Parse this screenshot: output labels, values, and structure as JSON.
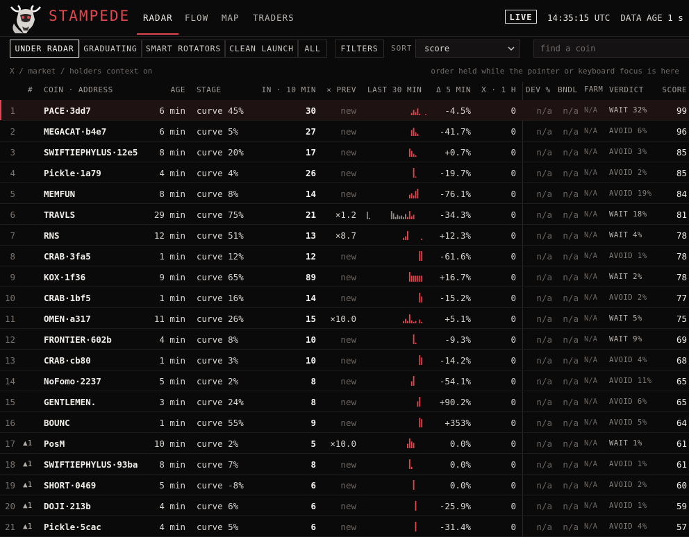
{
  "brand": "STAMPEDE",
  "nav": [
    "RADAR",
    "FLOW",
    "MAP",
    "TRADERS"
  ],
  "status": {
    "live": "LIVE",
    "time": "14:35:15",
    "tz": "UTC",
    "age_label": "DATA AGE",
    "age_value": "1 s"
  },
  "filters": [
    "UNDER RADAR",
    "GRADUATING",
    "SMART ROTATORS",
    "CLEAN LAUNCH",
    "ALL"
  ],
  "filters_button": "FILTERS",
  "sort": {
    "label": "SORT",
    "value": "score"
  },
  "search": {
    "placeholder": "find a coin"
  },
  "context": {
    "left": "X / market / holders context on",
    "right": "order held while the pointer or keyboard focus is here"
  },
  "columns": {
    "num": "#",
    "coin": "COIN · ADDRESS",
    "age": "AGE",
    "stage": "STAGE",
    "in10": "IN · 10 MIN",
    "prev": "× PREV",
    "last30": "LAST 30 MIN",
    "d5": "Δ 5 MIN",
    "x1h": "X · 1 H",
    "dev": "DEV %",
    "bndl": "BNDL",
    "farm": "FARM",
    "verdict": "VERDICT",
    "score": "SCORE"
  },
  "colors": {
    "accent": "#e0464e",
    "wait": "#b9b3ae",
    "avoid": "#85807b"
  },
  "rows": [
    {
      "num": "1",
      "trend": "",
      "coin": "PACE·3dd7",
      "age": "6 min",
      "stage": "curve 45%",
      "in10": "30",
      "prev": "new",
      "spark": [
        0,
        0,
        0,
        0,
        0,
        0,
        0,
        0,
        0,
        0,
        0,
        0,
        0,
        0,
        0,
        0,
        0,
        0,
        0,
        0,
        0,
        0,
        3,
        7,
        4,
        9,
        2,
        0,
        0,
        1
      ],
      "d5": "-4.5%",
      "x1h": "0",
      "dev": "n/a",
      "bndl": "n/a",
      "farm": "N/A",
      "verdict": "WAIT 32%",
      "score": "99"
    },
    {
      "num": "2",
      "trend": "",
      "coin": "MEGACAT·b4e7",
      "age": "6 min",
      "stage": "curve 5%",
      "in10": "27",
      "prev": "new",
      "spark": [
        0,
        0,
        0,
        0,
        0,
        0,
        0,
        0,
        0,
        0,
        0,
        0,
        0,
        0,
        0,
        0,
        0,
        0,
        0,
        0,
        0,
        0,
        8,
        11,
        5,
        3,
        0,
        0,
        0,
        0
      ],
      "d5": "-41.7%",
      "x1h": "0",
      "dev": "n/a",
      "bndl": "n/a",
      "farm": "N/A",
      "verdict": "AVOID 6%",
      "score": "96"
    },
    {
      "num": "3",
      "trend": "",
      "coin": "SWIFTIEPHYLUS·12e5",
      "age": "8 min",
      "stage": "curve 20%",
      "in10": "17",
      "prev": "new",
      "spark": [
        0,
        0,
        0,
        0,
        0,
        0,
        0,
        0,
        0,
        0,
        0,
        0,
        0,
        0,
        0,
        0,
        0,
        0,
        0,
        0,
        0,
        11,
        8,
        4,
        2,
        0,
        0,
        0,
        0,
        0
      ],
      "d5": "+0.7%",
      "x1h": "0",
      "dev": "n/a",
      "bndl": "n/a",
      "farm": "N/A",
      "verdict": "AVOID 3%",
      "score": "85"
    },
    {
      "num": "4",
      "trend": "",
      "coin": "Pickle·1a79",
      "age": "4 min",
      "stage": "curve 4%",
      "in10": "26",
      "prev": "new",
      "spark": [
        0,
        0,
        0,
        0,
        0,
        0,
        0,
        0,
        0,
        0,
        0,
        0,
        0,
        0,
        0,
        0,
        0,
        0,
        0,
        0,
        0,
        0,
        0,
        13,
        1,
        0,
        0,
        0,
        0,
        0
      ],
      "d5": "-19.7%",
      "x1h": "0",
      "dev": "n/a",
      "bndl": "n/a",
      "farm": "N/A",
      "verdict": "AVOID 2%",
      "score": "85"
    },
    {
      "num": "5",
      "trend": "",
      "coin": "MEMFUN",
      "age": "8 min",
      "stage": "curve 8%",
      "in10": "14",
      "prev": "new",
      "spark": [
        0,
        0,
        0,
        0,
        0,
        0,
        0,
        0,
        0,
        0,
        0,
        0,
        0,
        0,
        0,
        0,
        0,
        0,
        0,
        0,
        0,
        5,
        7,
        4,
        10,
        13,
        0,
        0,
        0,
        0
      ],
      "d5": "-76.1%",
      "x1h": "0",
      "dev": "n/a",
      "bndl": "n/a",
      "farm": "N/A",
      "verdict": "AVOID 19%",
      "score": "84"
    },
    {
      "num": "6",
      "trend": "",
      "coin": "TRAVLS",
      "age": "29 min",
      "stage": "curve 75%",
      "in10": "21",
      "prev": "×1.2",
      "spark": [
        10,
        2,
        0,
        0,
        0,
        0,
        0,
        0,
        0,
        0,
        0,
        0,
        11,
        8,
        3,
        6,
        4,
        5,
        3,
        7,
        3,
        11,
        4,
        6,
        0,
        0,
        0,
        0,
        0,
        0
      ],
      "d5": "-34.3%",
      "x1h": "0",
      "dev": "n/a",
      "bndl": "n/a",
      "farm": "N/A",
      "verdict": "WAIT 18%",
      "score": "81"
    },
    {
      "num": "7",
      "trend": "",
      "coin": "RNS",
      "age": "12 min",
      "stage": "curve 51%",
      "in10": "13",
      "prev": "×8.7",
      "spark": [
        0,
        0,
        0,
        0,
        0,
        0,
        0,
        0,
        0,
        0,
        0,
        0,
        0,
        0,
        0,
        0,
        0,
        0,
        3,
        5,
        12,
        0,
        0,
        0,
        0,
        0,
        0,
        2,
        0,
        0
      ],
      "d5": "+12.3%",
      "x1h": "0",
      "dev": "n/a",
      "bndl": "n/a",
      "farm": "N/A",
      "verdict": "WAIT 4%",
      "score": "78"
    },
    {
      "num": "8",
      "trend": "",
      "coin": "CRAB·3fa5",
      "age": "1 min",
      "stage": "curve 12%",
      "in10": "12",
      "prev": "new",
      "spark": [
        0,
        0,
        0,
        0,
        0,
        0,
        0,
        0,
        0,
        0,
        0,
        0,
        0,
        0,
        0,
        0,
        0,
        0,
        0,
        0,
        0,
        0,
        0,
        0,
        0,
        0,
        13,
        13,
        0,
        0
      ],
      "d5": "-61.6%",
      "x1h": "0",
      "dev": "n/a",
      "bndl": "n/a",
      "farm": "N/A",
      "verdict": "AVOID 1%",
      "score": "78"
    },
    {
      "num": "9",
      "trend": "",
      "coin": "KOX·1f36",
      "age": "9 min",
      "stage": "curve 65%",
      "in10": "89",
      "prev": "new",
      "spark": [
        0,
        0,
        0,
        0,
        0,
        0,
        0,
        0,
        0,
        0,
        0,
        0,
        0,
        0,
        0,
        0,
        0,
        0,
        0,
        0,
        0,
        13,
        8,
        8,
        8,
        8,
        8,
        8,
        0,
        0
      ],
      "d5": "+16.7%",
      "x1h": "0",
      "dev": "n/a",
      "bndl": "n/a",
      "farm": "N/A",
      "verdict": "WAIT 2%",
      "score": "78"
    },
    {
      "num": "10",
      "trend": "",
      "coin": "CRAB·1bf5",
      "age": "1 min",
      "stage": "curve 16%",
      "in10": "14",
      "prev": "new",
      "spark": [
        0,
        0,
        0,
        0,
        0,
        0,
        0,
        0,
        0,
        0,
        0,
        0,
        0,
        0,
        0,
        0,
        0,
        0,
        0,
        0,
        0,
        0,
        0,
        0,
        0,
        0,
        13,
        8,
        0,
        0
      ],
      "d5": "-15.2%",
      "x1h": "0",
      "dev": "n/a",
      "bndl": "n/a",
      "farm": "N/A",
      "verdict": "AVOID 2%",
      "score": "77"
    },
    {
      "num": "11",
      "trend": "",
      "coin": "OMEN·a317",
      "age": "11 min",
      "stage": "curve 26%",
      "in10": "15",
      "prev": "×10.0",
      "spark": [
        0,
        0,
        0,
        0,
        0,
        0,
        0,
        0,
        0,
        0,
        0,
        0,
        0,
        0,
        0,
        0,
        0,
        0,
        3,
        6,
        3,
        12,
        4,
        2,
        3,
        0,
        5,
        2,
        0,
        0
      ],
      "d5": "+5.1%",
      "x1h": "0",
      "dev": "n/a",
      "bndl": "n/a",
      "farm": "N/A",
      "verdict": "WAIT 5%",
      "score": "75"
    },
    {
      "num": "12",
      "trend": "",
      "coin": "FRONTIER·602b",
      "age": "4 min",
      "stage": "curve 8%",
      "in10": "10",
      "prev": "new",
      "spark": [
        0,
        0,
        0,
        0,
        0,
        0,
        0,
        0,
        0,
        0,
        0,
        0,
        0,
        0,
        0,
        0,
        0,
        0,
        0,
        0,
        0,
        0,
        0,
        13,
        2,
        0,
        0,
        0,
        0,
        0
      ],
      "d5": "-9.3%",
      "x1h": "0",
      "dev": "n/a",
      "bndl": "n/a",
      "farm": "N/A",
      "verdict": "WAIT 9%",
      "score": "69"
    },
    {
      "num": "13",
      "trend": "",
      "coin": "CRAB·cb80",
      "age": "1 min",
      "stage": "curve 3%",
      "in10": "10",
      "prev": "new",
      "spark": [
        0,
        0,
        0,
        0,
        0,
        0,
        0,
        0,
        0,
        0,
        0,
        0,
        0,
        0,
        0,
        0,
        0,
        0,
        0,
        0,
        0,
        0,
        0,
        0,
        0,
        0,
        13,
        10,
        0,
        0
      ],
      "d5": "-14.2%",
      "x1h": "0",
      "dev": "n/a",
      "bndl": "n/a",
      "farm": "N/A",
      "verdict": "AVOID 4%",
      "score": "68"
    },
    {
      "num": "14",
      "trend": "",
      "coin": "NoFomo·2237",
      "age": "5 min",
      "stage": "curve 2%",
      "in10": "8",
      "prev": "new",
      "spark": [
        0,
        0,
        0,
        0,
        0,
        0,
        0,
        0,
        0,
        0,
        0,
        0,
        0,
        0,
        0,
        0,
        0,
        0,
        0,
        0,
        0,
        0,
        6,
        13,
        0,
        0,
        0,
        0,
        0,
        0
      ],
      "d5": "-54.1%",
      "x1h": "0",
      "dev": "n/a",
      "bndl": "n/a",
      "farm": "N/A",
      "verdict": "AVOID 11%",
      "score": "65"
    },
    {
      "num": "15",
      "trend": "",
      "coin": "GENTLEMEN.",
      "age": "3 min",
      "stage": "curve 24%",
      "in10": "8",
      "prev": "new",
      "spark": [
        0,
        0,
        0,
        0,
        0,
        0,
        0,
        0,
        0,
        0,
        0,
        0,
        0,
        0,
        0,
        0,
        0,
        0,
        0,
        0,
        0,
        0,
        0,
        0,
        0,
        7,
        13,
        0,
        0,
        0
      ],
      "d5": "+90.2%",
      "x1h": "0",
      "dev": "n/a",
      "bndl": "n/a",
      "farm": "N/A",
      "verdict": "AVOID 6%",
      "score": "65"
    },
    {
      "num": "16",
      "trend": "",
      "coin": "BOUNC",
      "age": "1 min",
      "stage": "curve 55%",
      "in10": "9",
      "prev": "new",
      "spark": [
        0,
        0,
        0,
        0,
        0,
        0,
        0,
        0,
        0,
        0,
        0,
        0,
        0,
        0,
        0,
        0,
        0,
        0,
        0,
        0,
        0,
        0,
        0,
        0,
        0,
        0,
        13,
        11,
        0,
        0
      ],
      "d5": "+353%",
      "x1h": "0",
      "dev": "n/a",
      "bndl": "n/a",
      "farm": "N/A",
      "verdict": "AVOID 5%",
      "score": "64"
    },
    {
      "num": "17",
      "trend": "▲1",
      "coin": "PosM",
      "age": "10 min",
      "stage": "curve 2%",
      "in10": "5",
      "prev": "×10.0",
      "spark": [
        0,
        0,
        0,
        0,
        0,
        0,
        0,
        0,
        0,
        0,
        0,
        0,
        0,
        0,
        0,
        0,
        0,
        0,
        0,
        0,
        6,
        13,
        9,
        7,
        0,
        0,
        0,
        0,
        0,
        0
      ],
      "d5": "0.0%",
      "x1h": "0",
      "dev": "n/a",
      "bndl": "n/a",
      "farm": "N/A",
      "verdict": "WAIT 1%",
      "score": "61"
    },
    {
      "num": "18",
      "trend": "▲1",
      "coin": "SWIFTIEPHYLUS·93ba",
      "age": "8 min",
      "stage": "curve 7%",
      "in10": "8",
      "prev": "new",
      "spark": [
        0,
        0,
        0,
        0,
        0,
        0,
        0,
        0,
        0,
        0,
        0,
        0,
        0,
        0,
        0,
        0,
        0,
        0,
        0,
        0,
        0,
        13,
        3,
        0,
        0,
        0,
        0,
        0,
        0,
        0
      ],
      "d5": "0.0%",
      "x1h": "0",
      "dev": "n/a",
      "bndl": "n/a",
      "farm": "N/A",
      "verdict": "AVOID 1%",
      "score": "61"
    },
    {
      "num": "19",
      "trend": "▲1",
      "coin": "SHORT·0469",
      "age": "5 min",
      "stage": "curve -8%",
      "in10": "6",
      "prev": "new",
      "spark": [
        0,
        0,
        0,
        0,
        0,
        0,
        0,
        0,
        0,
        0,
        0,
        0,
        0,
        0,
        0,
        0,
        0,
        0,
        0,
        0,
        0,
        0,
        0,
        13,
        0,
        0,
        0,
        0,
        0,
        0
      ],
      "d5": "0.0%",
      "x1h": "0",
      "dev": "n/a",
      "bndl": "n/a",
      "farm": "N/A",
      "verdict": "AVOID 2%",
      "score": "60"
    },
    {
      "num": "20",
      "trend": "▲1",
      "coin": "DOJI·213b",
      "age": "4 min",
      "stage": "curve 6%",
      "in10": "6",
      "prev": "new",
      "spark": [
        0,
        0,
        0,
        0,
        0,
        0,
        0,
        0,
        0,
        0,
        0,
        0,
        0,
        0,
        0,
        0,
        0,
        0,
        0,
        0,
        0,
        0,
        0,
        0,
        13,
        0,
        0,
        0,
        0,
        0
      ],
      "d5": "-25.9%",
      "x1h": "0",
      "dev": "n/a",
      "bndl": "n/a",
      "farm": "N/A",
      "verdict": "AVOID 1%",
      "score": "59"
    },
    {
      "num": "21",
      "trend": "▲1",
      "coin": "Pickle·5cac",
      "age": "4 min",
      "stage": "curve 5%",
      "in10": "6",
      "prev": "new",
      "spark": [
        0,
        0,
        0,
        0,
        0,
        0,
        0,
        0,
        0,
        0,
        0,
        0,
        0,
        0,
        0,
        0,
        0,
        0,
        0,
        0,
        0,
        0,
        0,
        0,
        13,
        0,
        0,
        0,
        0,
        0
      ],
      "d5": "-31.4%",
      "x1h": "0",
      "dev": "n/a",
      "bndl": "n/a",
      "farm": "N/A",
      "verdict": "AVOID 4%",
      "score": "57"
    }
  ]
}
